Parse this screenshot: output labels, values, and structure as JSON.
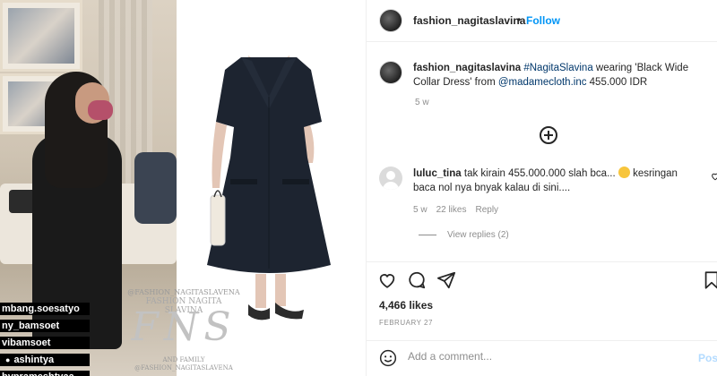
{
  "media": {
    "story_handles": [
      "mbang.soesatyo",
      "ny_bamsoet",
      "vibamsoet",
      "ashintya",
      "byprameshtyaa"
    ],
    "watermark_top": "@FASHION_NAGITASLAVENA",
    "watermark_mid": "FASHION NAGITA SLAVINA",
    "watermark_logo": "FNS",
    "watermark_bottom": "AND FAMILY\n@FASHION_NAGITASLAVENA"
  },
  "header": {
    "username": "fashion_nagitaslavina",
    "separator": "•",
    "follow_label": "Follow"
  },
  "caption": {
    "username": "fashion_nagitaslavina",
    "hashtag": "#NagitaSlavina",
    "text_1": " wearing 'Black Wide Collar Dress' from ",
    "mention": "@madamecloth.inc",
    "text_2": " 455.000 IDR",
    "time": "5 w"
  },
  "comment": {
    "username": "luluc_tina",
    "text_1": " tak kirain 455.000.000 slah bca...",
    "text_2": " kesringan baca nol nya bnyak kalau di sini....",
    "time": "5 w",
    "likes": "22 likes",
    "reply_label": "Reply",
    "view_replies": "View replies (2)"
  },
  "post": {
    "likes": "4,466 likes",
    "date": "FEBRUARY 27"
  },
  "add_comment": {
    "placeholder": "Add a comment...",
    "post_label": "Post"
  },
  "colors": {
    "accent": "#0095f6",
    "link": "#00376b",
    "muted": "#8e8e8e",
    "text": "#262626",
    "post_disabled": "#b3dbff"
  }
}
